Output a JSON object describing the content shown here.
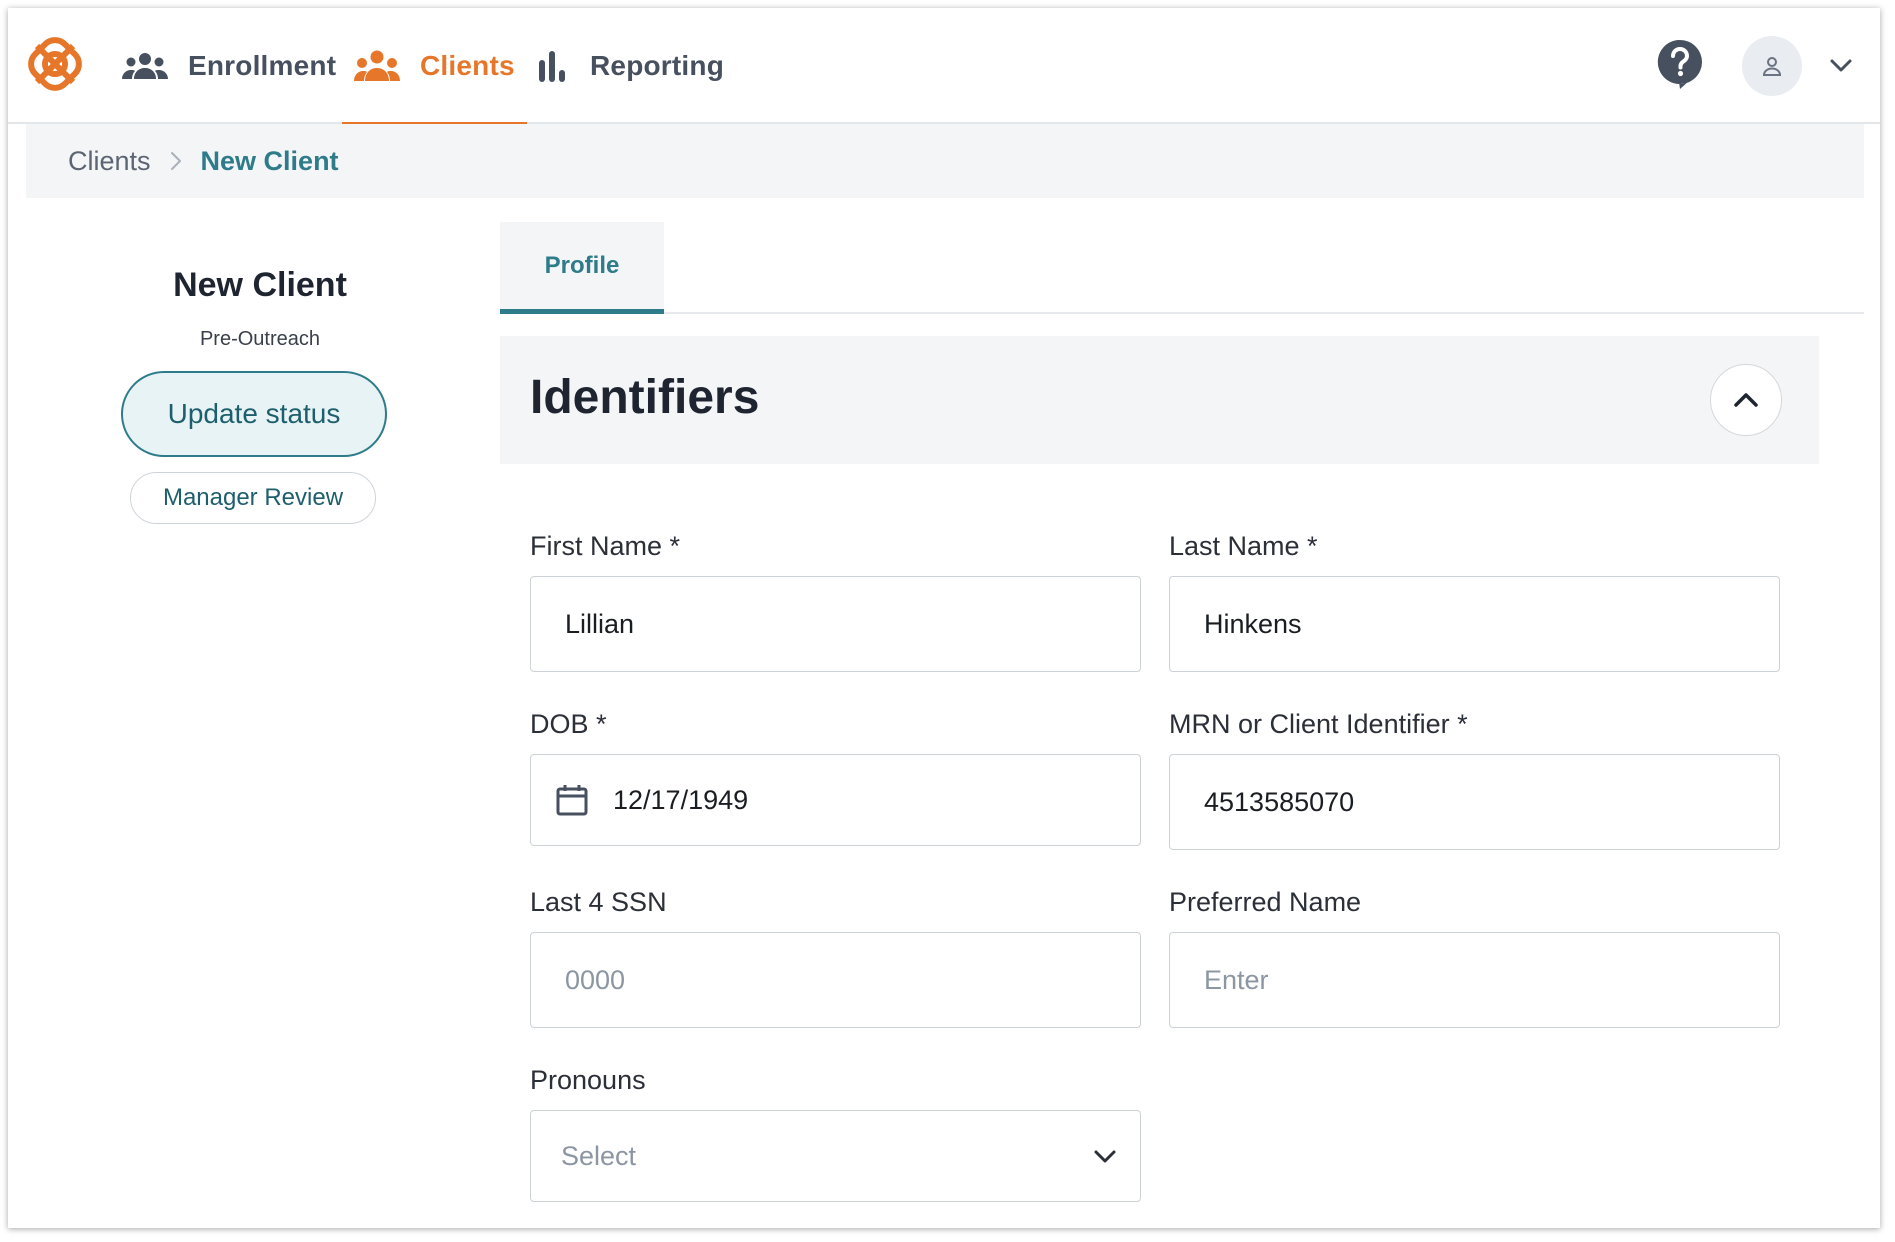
{
  "nav": {
    "items": [
      {
        "label": "Enrollment",
        "icon": "people-group-icon",
        "active": false
      },
      {
        "label": "Clients",
        "icon": "clients-group-icon",
        "active": true
      },
      {
        "label": "Reporting",
        "icon": "bar-chart-icon",
        "active": false
      }
    ]
  },
  "breadcrumb": {
    "root": "Clients",
    "current": "New Client"
  },
  "client": {
    "name": "New Client",
    "status": "Pre-Outreach",
    "update_status_label": "Update status",
    "manager_review_label": "Manager Review"
  },
  "tabs": [
    {
      "label": "Profile",
      "active": true
    }
  ],
  "section": {
    "title": "Identifiers"
  },
  "form": {
    "first_name": {
      "label": "First Name *",
      "value": "Lillian"
    },
    "last_name": {
      "label": "Last Name *",
      "value": "Hinkens"
    },
    "dob": {
      "label": "DOB *",
      "value": "12/17/1949"
    },
    "mrn": {
      "label": "MRN or Client Identifier *",
      "value": "4513585070"
    },
    "ssn": {
      "label": "Last 4 SSN",
      "placeholder": "0000"
    },
    "preferred_name": {
      "label": "Preferred Name",
      "placeholder": "Enter"
    },
    "pronouns": {
      "label": "Pronouns",
      "placeholder": "Select"
    }
  },
  "colors": {
    "accent_orange": "#e6772a",
    "accent_teal": "#2e7b8a"
  }
}
